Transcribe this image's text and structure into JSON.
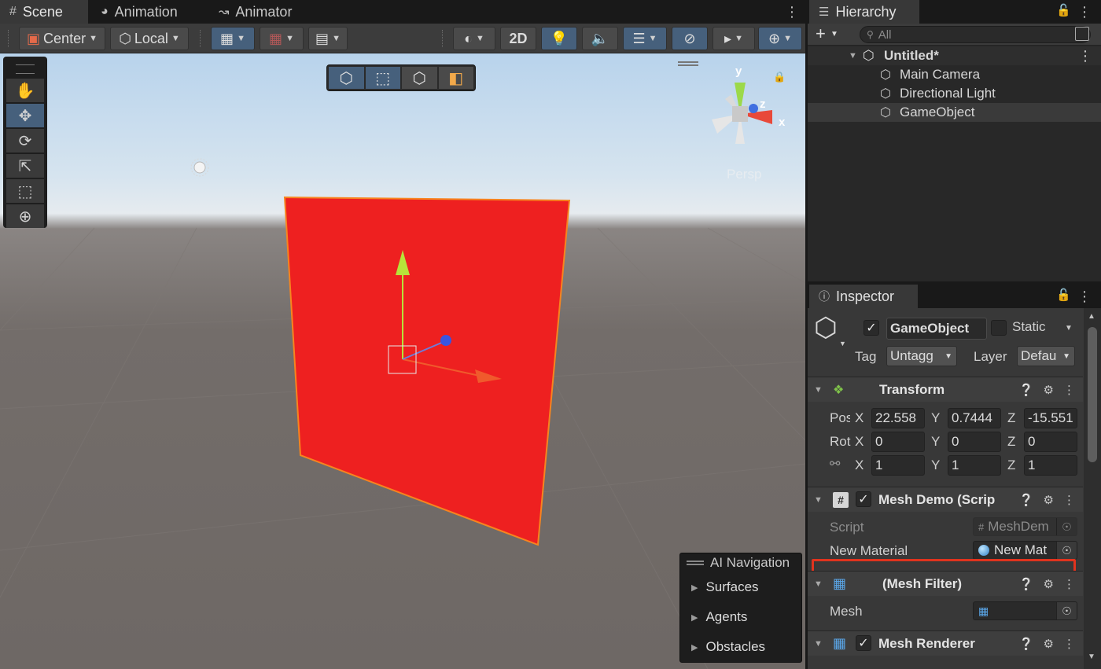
{
  "scene": {
    "tabs": [
      {
        "label": "Scene",
        "icon": "grid-hash-icon"
      },
      {
        "label": "Animation",
        "icon": "animation-clock-icon"
      },
      {
        "label": "Animator",
        "icon": "animator-icon"
      }
    ],
    "toolbar": {
      "pivot_mode": "Center",
      "pivot_rotation": "Local",
      "mode_2d": "2D"
    },
    "view_label": "Persp",
    "gizmo_axes": {
      "y": "y",
      "z": "z",
      "x": "x"
    },
    "ai_navigation": {
      "title": "AI Navigation",
      "items": [
        "Surfaces",
        "Agents",
        "Obstacles"
      ]
    },
    "colors": {
      "plane": "#ee2020",
      "plane_outline": "#f7841f",
      "selection": "#46607c"
    }
  },
  "hierarchy": {
    "tab_label": "Hierarchy",
    "search_placeholder": "All",
    "scene_name": "Untitled*",
    "items": [
      "Main Camera",
      "Directional Light",
      "GameObject"
    ],
    "selected": "GameObject"
  },
  "inspector": {
    "tab_label": "Inspector",
    "object_name": "GameObject",
    "static_label": "Static",
    "tag_label": "Tag",
    "tag_value": "Untagg",
    "layer_label": "Layer",
    "layer_value": "Defau",
    "transform": {
      "title": "Transform",
      "pos_label": "Pos",
      "rot_label": "Rot",
      "position": {
        "x": "22.558",
        "y": "0.7444",
        "z": "-15.551"
      },
      "rotation": {
        "x": "0",
        "y": "0",
        "z": "0"
      },
      "scale": {
        "x": "1",
        "y": "1",
        "z": "1"
      }
    },
    "axis_labels": {
      "x": "X",
      "y": "Y",
      "z": "Z"
    },
    "mesh_demo": {
      "title": "Mesh Demo (Scrip",
      "script_label": "Script",
      "script_value": "MeshDem",
      "material_label": "New Material",
      "material_value": "New Mat"
    },
    "mesh_filter": {
      "title": "(Mesh Filter)",
      "mesh_label": "Mesh",
      "mesh_value": ""
    },
    "mesh_renderer": {
      "title": "Mesh Renderer"
    }
  }
}
